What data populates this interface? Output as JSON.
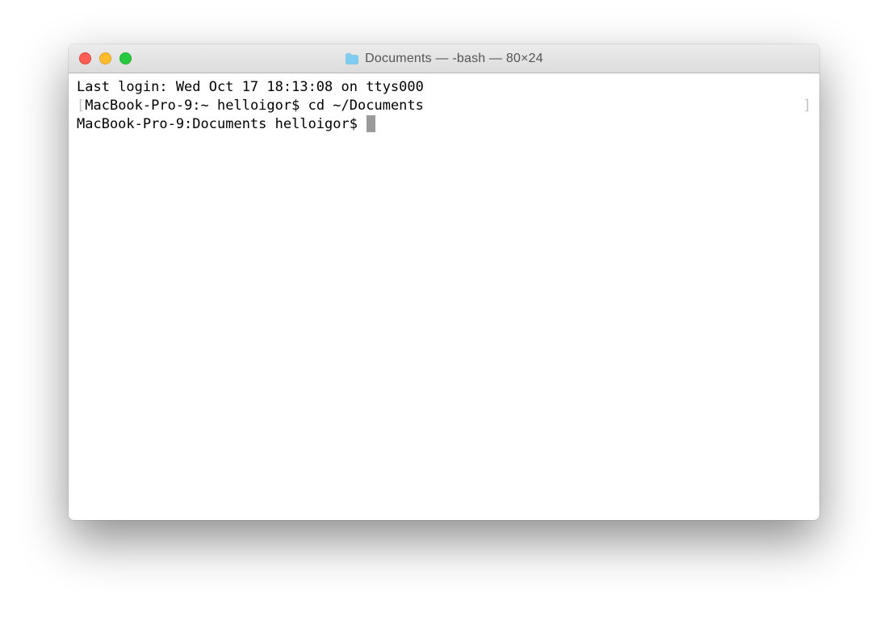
{
  "window": {
    "title": "Documents — -bash — 80×24"
  },
  "terminal": {
    "last_login": "Last login: Wed Oct 17 18:13:08 on ttys000",
    "line1": {
      "lbracket": "[",
      "prompt": "MacBook-Pro-9:~ helloigor$ ",
      "command": "cd ~/Documents",
      "rbracket": "]"
    },
    "line2": {
      "prompt": "MacBook-Pro-9:Documents helloigor$ "
    }
  }
}
